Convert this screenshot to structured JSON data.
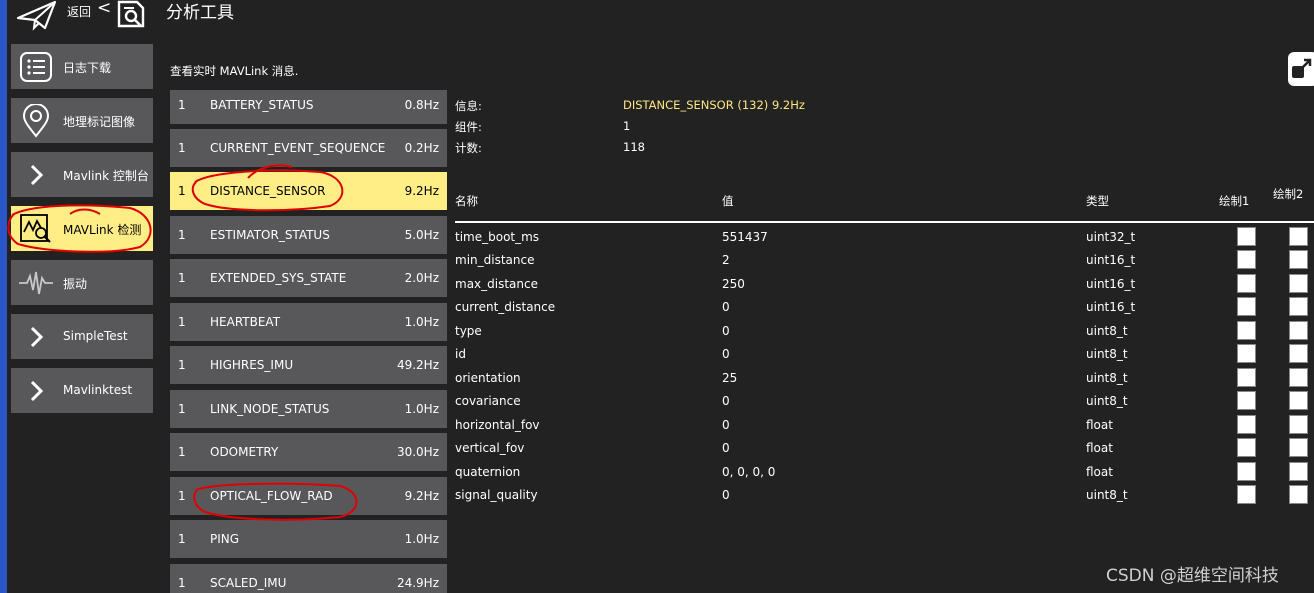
{
  "topbar": {
    "back_label": "返回",
    "chevron": "<",
    "title": "分析工具",
    "back_icon": "paper-plane-icon",
    "title_icon": "document-search-icon"
  },
  "sidebar": {
    "items": [
      {
        "label": "日志下载",
        "icon": "list-icon"
      },
      {
        "label": "地理标记图像",
        "icon": "map-pin-icon"
      },
      {
        "label": "Mavlink 控制台",
        "icon": "chevron-right-icon"
      },
      {
        "label": "MAVLink 检测",
        "icon": "chart-search-icon",
        "active": true
      },
      {
        "label": "振动",
        "icon": "waveform-icon"
      },
      {
        "label": "SimpleTest",
        "icon": "chevron-right-icon"
      },
      {
        "label": "Mavlinktest",
        "icon": "chevron-right-icon"
      }
    ]
  },
  "description": "查看实时 MAVLink 消息.",
  "messages": [
    {
      "comp": "1",
      "name": "BATTERY_STATUS",
      "rate": "0.8Hz"
    },
    {
      "comp": "1",
      "name": "CURRENT_EVENT_SEQUENCE",
      "rate": "0.2Hz"
    },
    {
      "comp": "1",
      "name": "DISTANCE_SENSOR",
      "rate": "9.2Hz",
      "active": true
    },
    {
      "comp": "1",
      "name": "ESTIMATOR_STATUS",
      "rate": "5.0Hz"
    },
    {
      "comp": "1",
      "name": "EXTENDED_SYS_STATE",
      "rate": "2.0Hz"
    },
    {
      "comp": "1",
      "name": "HEARTBEAT",
      "rate": "1.0Hz"
    },
    {
      "comp": "1",
      "name": "HIGHRES_IMU",
      "rate": "49.2Hz"
    },
    {
      "comp": "1",
      "name": "LINK_NODE_STATUS",
      "rate": "1.0Hz"
    },
    {
      "comp": "1",
      "name": "ODOMETRY",
      "rate": "30.0Hz"
    },
    {
      "comp": "1",
      "name": "OPTICAL_FLOW_RAD",
      "rate": "9.2Hz"
    },
    {
      "comp": "1",
      "name": "PING",
      "rate": "1.0Hz"
    },
    {
      "comp": "1",
      "name": "SCALED_IMU",
      "rate": "24.9Hz"
    }
  ],
  "info": {
    "message_label": "信息:",
    "message_value": "DISTANCE_SENSOR (132) 9.2Hz",
    "component_label": "组件:",
    "component_value": "1",
    "count_label": "计数:",
    "count_value": "118"
  },
  "table": {
    "headers": {
      "name": "名称",
      "value": "值",
      "type": "类型",
      "plot1": "绘制1",
      "plot2": "绘制2"
    },
    "rows": [
      {
        "name": "time_boot_ms",
        "value": "551437",
        "type": "uint32_t"
      },
      {
        "name": "min_distance",
        "value": "2",
        "type": "uint16_t"
      },
      {
        "name": "max_distance",
        "value": "250",
        "type": "uint16_t"
      },
      {
        "name": "current_distance",
        "value": "0",
        "type": "uint16_t"
      },
      {
        "name": "type",
        "value": "0",
        "type": "uint8_t"
      },
      {
        "name": "id",
        "value": "0",
        "type": "uint8_t"
      },
      {
        "name": "orientation",
        "value": "25",
        "type": "uint8_t"
      },
      {
        "name": "covariance",
        "value": "0",
        "type": "uint8_t"
      },
      {
        "name": "horizontal_fov",
        "value": "0",
        "type": "float"
      },
      {
        "name": "vertical_fov",
        "value": "0",
        "type": "float"
      },
      {
        "name": "quaternion",
        "value": "0, 0, 0, 0",
        "type": "float"
      },
      {
        "name": "signal_quality",
        "value": "0",
        "type": "uint8_t"
      }
    ]
  },
  "watermark": "CSDN @超维空间科技",
  "colors": {
    "active_bg": "#ffee86",
    "item_bg": "#58585a",
    "page_bg": "#222222",
    "accent_text": "#ffe680",
    "annotation": "#e00000"
  }
}
